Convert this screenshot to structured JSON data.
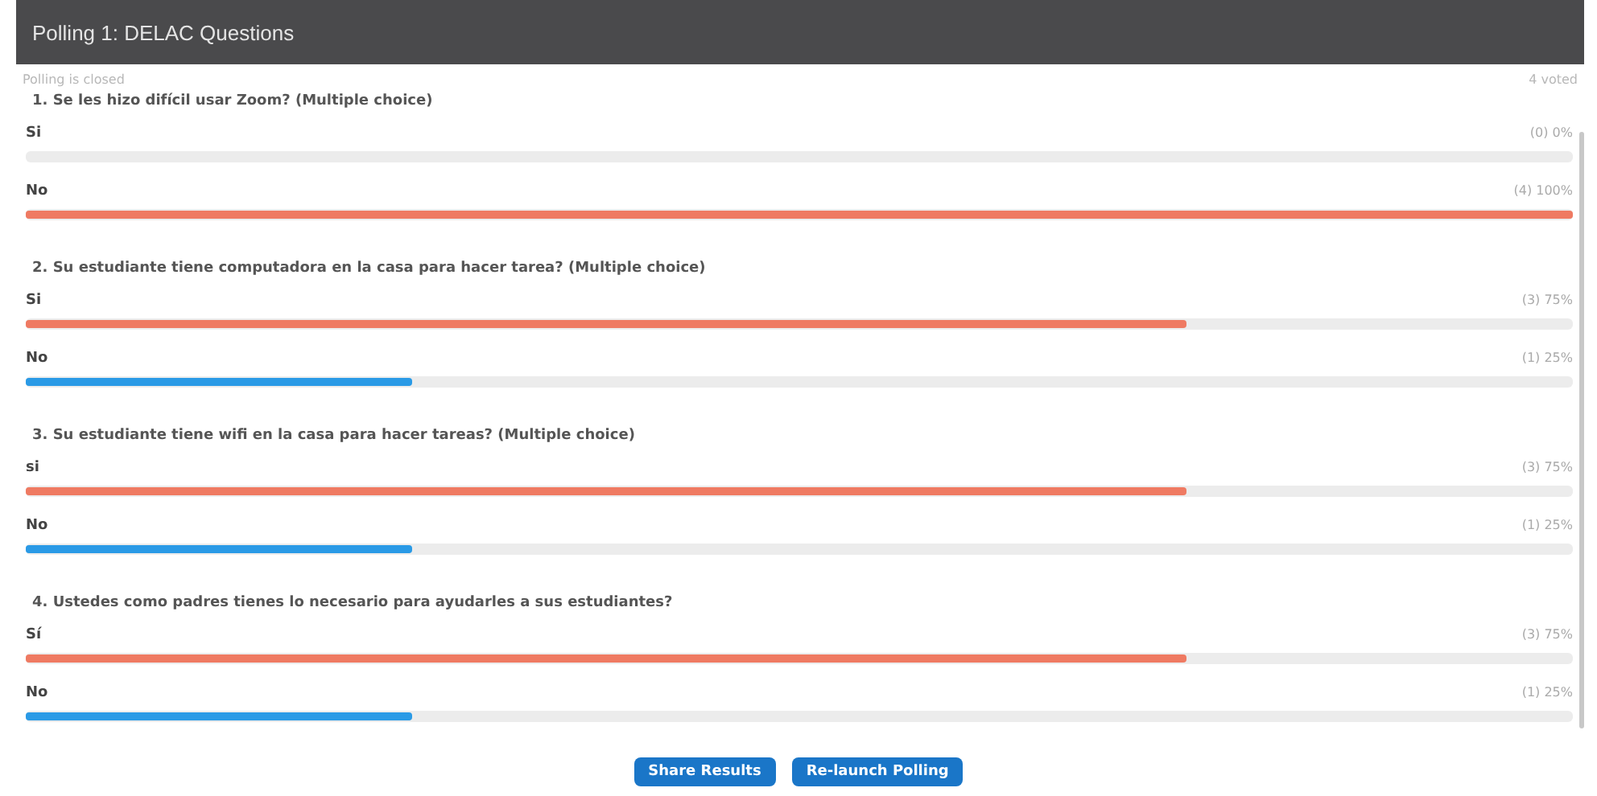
{
  "window": {
    "title": "Polling 1: DELAC Questions"
  },
  "status": "Polling is closed",
  "votes": "4 voted",
  "questions": [
    {
      "title": "1. Se les hizo difícil usar Zoom? (Multiple choice)",
      "answers": [
        {
          "label": "Si",
          "result": "(0) 0%"
        },
        {
          "label": "No",
          "result": "(4) 100%",
          "level": 1,
          "color": "#ef7a62"
        }
      ]
    },
    {
      "title": "2. Su estudiante tiene computadora en la casa para hacer tarea? (Multiple choice)",
      "answers": [
        {
          "label": "Si",
          "result": "(3) 75%",
          "level": 0.75,
          "color": "#ef7a62"
        },
        {
          "label": "No",
          "result": "(1) 25%",
          "level": 0.25,
          "color": "#2a9ae6"
        }
      ]
    },
    {
      "title": "3. Su estudiante tiene wifi en la casa para hacer tareas? (Multiple choice)",
      "answers": [
        {
          "label": "si",
          "result": "(3) 75%",
          "level": 0.75,
          "color": "#ef7a62"
        },
        {
          "label": "No",
          "result": "(1) 25%",
          "level": 0.25,
          "color": "#2a9ae6"
        }
      ]
    },
    {
      "title": "4. Ustedes como padres tienes lo necesario para ayudarles a sus estudiantes?",
      "answers": [
        {
          "label": "Sí",
          "result": "(3) 75%",
          "level": 0.75,
          "color": "#ef7a62"
        },
        {
          "label": "No",
          "result": "(1) 25%",
          "level": 0.25,
          "color": "#2a9ae6"
        }
      ]
    }
  ],
  "buttons": [
    "Share Results",
    "Re-launch Polling"
  ]
}
